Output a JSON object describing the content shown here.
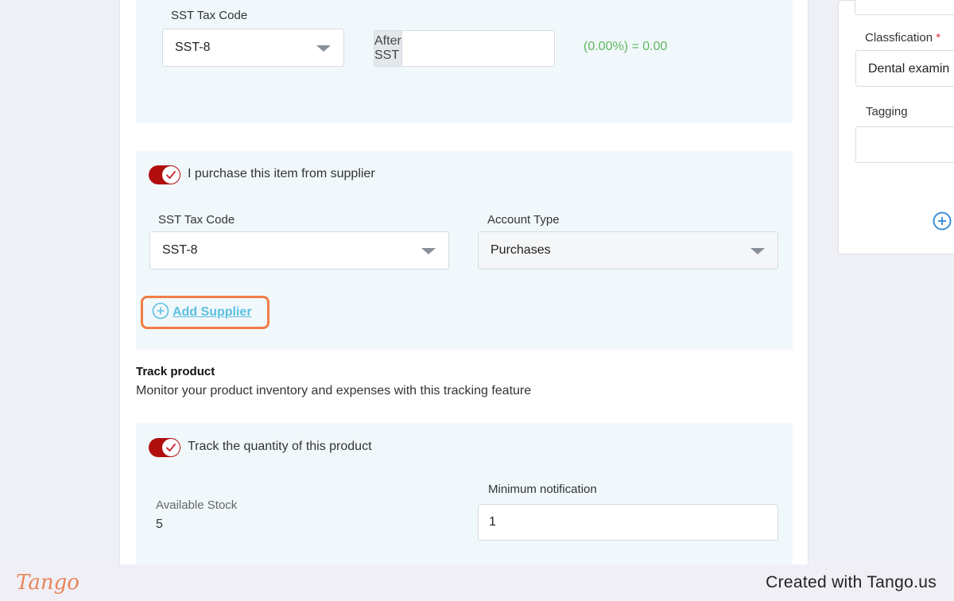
{
  "pricing_section": {
    "sst_label": "SST Tax Code",
    "sst_value": "SST-8",
    "after_sst_prefix": "After SST",
    "after_sst_value": "",
    "tax_result": "(0.00%) = 0.00"
  },
  "supplier_section": {
    "toggle_label": "I purchase this item from supplier",
    "toggle_on": true,
    "sst_label": "SST Tax Code",
    "sst_value": "SST-8",
    "account_type_label": "Account Type",
    "account_type_value": "Purchases",
    "add_supplier_label": "Add Supplier"
  },
  "track_product": {
    "title": "Track product",
    "description": "Monitor your product inventory and expenses with this tracking feature",
    "toggle_label": "Track the quantity of this product",
    "toggle_on": true,
    "available_stock_label": "Available Stock",
    "available_stock_value": "5",
    "min_notification_label": "Minimum notification",
    "min_notification_value": "1"
  },
  "side_panel": {
    "classification_label": "Classfication",
    "required_mark": "*",
    "classification_value": "Dental examin",
    "tagging_label": "Tagging",
    "tagging_value": ""
  },
  "footer": {
    "logo": "Tango",
    "credit": "Created with Tango.us"
  },
  "colors": {
    "accent_red": "#b10e0e",
    "link_blue": "#5bc0de",
    "highlight_orange": "#f07d45",
    "success_green": "#5cb85c"
  }
}
